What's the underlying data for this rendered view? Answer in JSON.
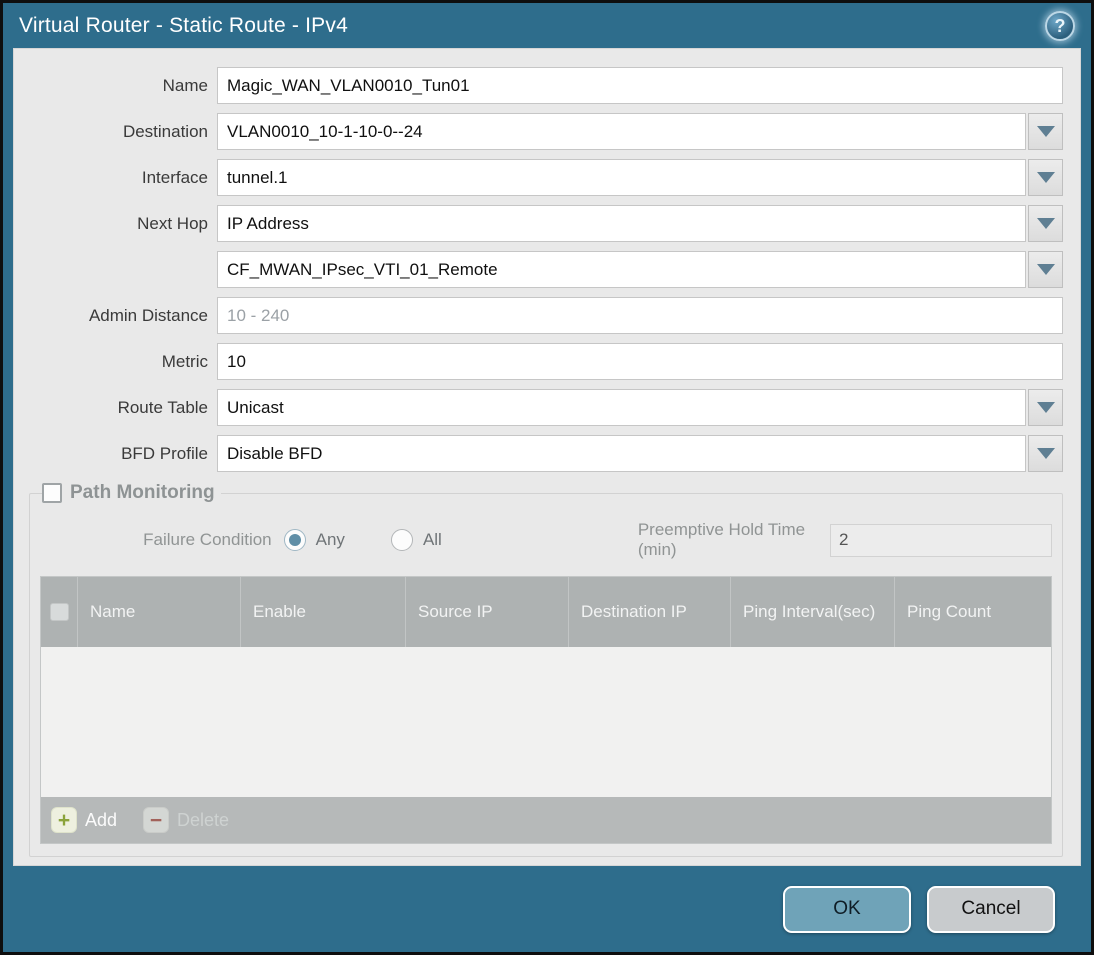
{
  "dialog": {
    "title": "Virtual Router - Static Route - IPv4",
    "help_icon": "?"
  },
  "form": {
    "name": {
      "label": "Name",
      "value": "Magic_WAN_VLAN0010_Tun01"
    },
    "destination": {
      "label": "Destination",
      "value": "VLAN0010_10-1-10-0--24"
    },
    "interface": {
      "label": "Interface",
      "value": "tunnel.1"
    },
    "next_hop": {
      "label": "Next Hop",
      "value": "IP Address"
    },
    "next_hop_address": {
      "value": "CF_MWAN_IPsec_VTI_01_Remote"
    },
    "admin_distance": {
      "label": "Admin Distance",
      "value": "",
      "placeholder": "10 - 240"
    },
    "metric": {
      "label": "Metric",
      "value": "10"
    },
    "route_table": {
      "label": "Route Table",
      "value": "Unicast"
    },
    "bfd_profile": {
      "label": "BFD Profile",
      "value": "Disable BFD"
    }
  },
  "path_monitoring": {
    "legend": "Path Monitoring",
    "checkbox_checked": "false",
    "failure_condition": {
      "label": "Failure Condition",
      "options": [
        {
          "label": "Any",
          "selected": "true"
        },
        {
          "label": "All",
          "selected": "false"
        }
      ]
    },
    "preemptive_hold_time": {
      "label": "Preemptive Hold Time (min)",
      "value": "2"
    },
    "table": {
      "columns": [
        "Name",
        "Enable",
        "Source IP",
        "Destination IP",
        "Ping Interval(sec)",
        "Ping Count"
      ],
      "rows": []
    },
    "add_label": "Add",
    "delete_label": "Delete"
  },
  "footer": {
    "ok_label": "OK",
    "cancel_label": "Cancel"
  },
  "colors": {
    "titlebar_teal": "#2e6d8c",
    "panel_gray": "#e9e9e9",
    "table_header_gray": "#aeb2b2",
    "ok_button": "#6fa3b8",
    "cancel_button": "#c8cbcd",
    "radio_selected": "#5f8ea6",
    "add_plus_green": "#8ba33b",
    "delete_minus_red": "#a2625a"
  }
}
